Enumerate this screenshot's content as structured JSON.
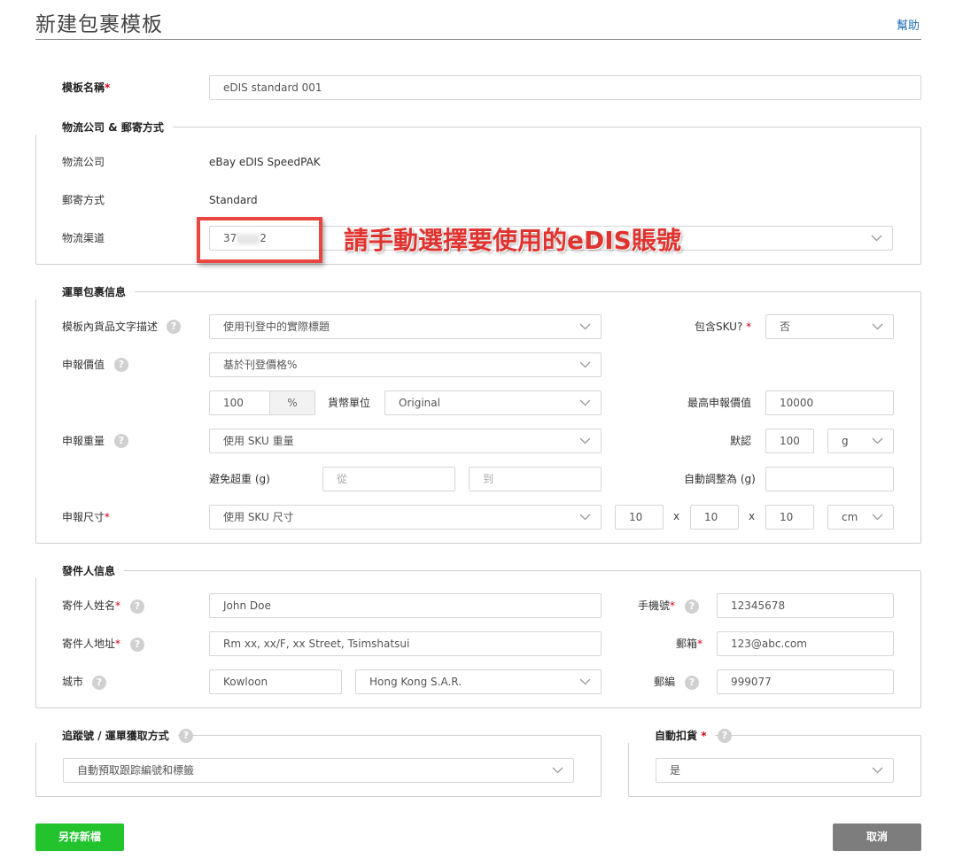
{
  "header": {
    "title": "新建包裹模板",
    "help": "幫助"
  },
  "template": {
    "label": "模板名稱",
    "value": "eDIS standard 001"
  },
  "logistics": {
    "legend": "物流公司 & 郵寄方式",
    "company_label": "物流公司",
    "company_value": "eBay eDIS SpeedPAK",
    "method_label": "郵寄方式",
    "method_value": "Standard",
    "channel_label": "物流渠道",
    "channel_value_prefix": "37",
    "channel_value_suffix": "2",
    "annotation": "請手動選擇要使用的eDIS賬號"
  },
  "parcel": {
    "legend": "運單包裹信息",
    "desc_label": "模板內貨品文字描述",
    "desc_value": "使用刊登中的實際標題",
    "sku_label": "包含SKU?",
    "sku_value": "否",
    "declared_value_label": "申報價值",
    "declared_value_value": "基於刊登價格%",
    "percent_value": "100",
    "percent_unit": "%",
    "currency_label": "貨幣單位",
    "currency_value": "Original",
    "max_declared_label": "最高申報價值",
    "max_declared_value": "10000",
    "weight_label": "申報重量",
    "weight_value": "使用 SKU 重量",
    "default_label": "默認",
    "default_value": "100",
    "weight_unit": "g",
    "avoid_label": "避免超重 (g)",
    "from_placeholder": "從",
    "to_placeholder": "到",
    "auto_adjust_label": "自動調整為 (g)",
    "auto_adjust_value": "",
    "size_label": "申報尺寸",
    "size_value": "使用 SKU 尺寸",
    "length": "10",
    "width": "10",
    "height": "10",
    "size_unit": "cm",
    "times": "x"
  },
  "sender": {
    "legend": "發件人信息",
    "name_label": "寄件人姓名",
    "name_value": "John Doe",
    "phone_label": "手機號",
    "phone_value": "12345678",
    "address_label": "寄件人地址",
    "address_value": "Rm xx, xx/F, xx Street, Tsimshatsui",
    "email_label": "郵箱",
    "email_value": "123@abc.com",
    "city_label": "城市",
    "city_value": "Kowloon",
    "region_value": "Hong Kong S.A.R.",
    "zip_label": "郵編",
    "zip_value": "999077"
  },
  "tracking": {
    "legend": "追蹤號 / 運單獲取方式",
    "value": "自動預取跟踪編號和標籤"
  },
  "deduct": {
    "legend": "自動扣貨",
    "value": "是"
  },
  "buttons": {
    "save_as": "另存新檔",
    "cancel": "取消"
  },
  "colors": {
    "accent_green": "#22c32d",
    "cancel_grey": "#7d7d7d",
    "annotation_red": "#e0332f",
    "required_red": "#d0021b",
    "help_blue": "#1f6fb8"
  }
}
